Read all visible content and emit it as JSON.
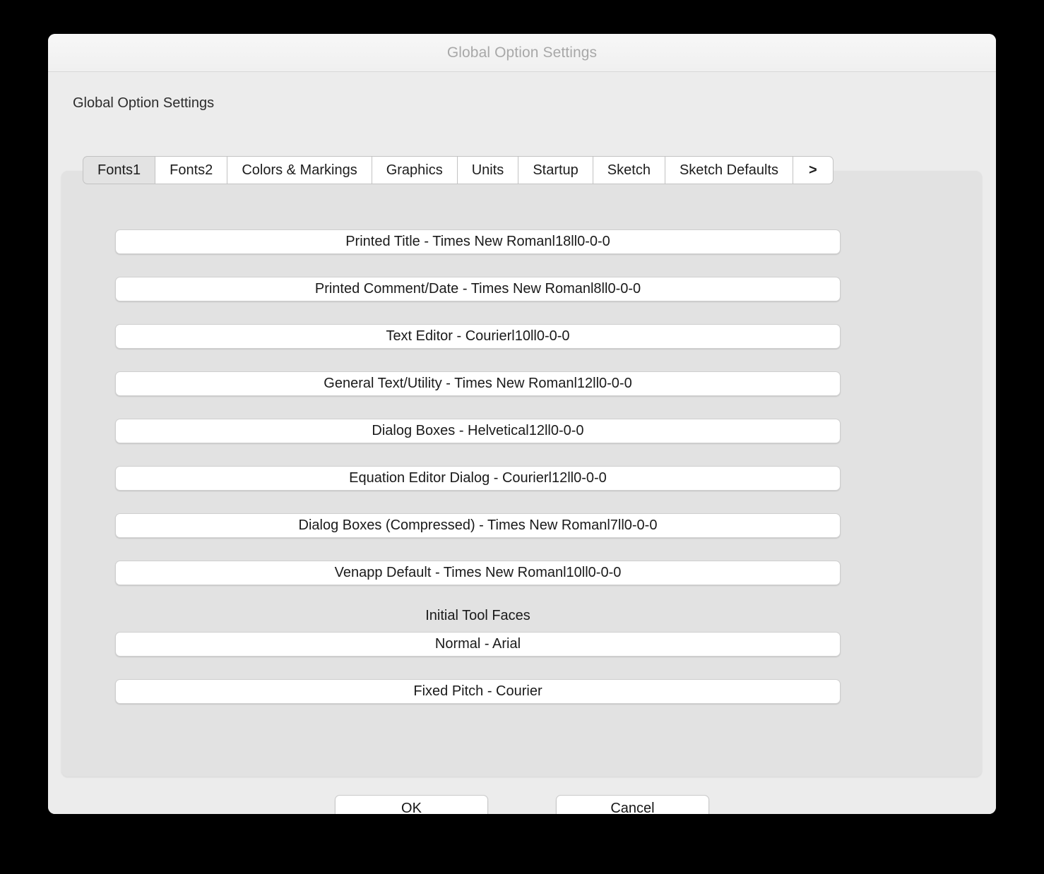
{
  "window": {
    "title": "Global Option Settings"
  },
  "group": {
    "label": "Global Option Settings"
  },
  "tabs": [
    {
      "label": "Fonts1",
      "active": true
    },
    {
      "label": "Fonts2",
      "active": false
    },
    {
      "label": "Colors & Markings",
      "active": false
    },
    {
      "label": "Graphics",
      "active": false
    },
    {
      "label": "Units",
      "active": false
    },
    {
      "label": "Startup",
      "active": false
    },
    {
      "label": "Sketch",
      "active": false
    },
    {
      "label": "Sketch Defaults",
      "active": false
    },
    {
      "label": ">",
      "active": false
    }
  ],
  "fonts1": {
    "fields": [
      {
        "value": "Printed Title - Times New Romanl18ll0-0-0"
      },
      {
        "value": "Printed Comment/Date - Times New Romanl8ll0-0-0"
      },
      {
        "value": "Text Editor - Courierl10ll0-0-0"
      },
      {
        "value": "General Text/Utility - Times New Romanl12ll0-0-0"
      },
      {
        "value": "Dialog Boxes - Helvetical12ll0-0-0"
      },
      {
        "value": "Equation Editor Dialog - Courierl12ll0-0-0"
      },
      {
        "value": "Dialog Boxes (Compressed) - Times New Romanl7ll0-0-0"
      },
      {
        "value": "Venapp Default - Times New Romanl10ll0-0-0"
      }
    ],
    "initial_tool_faces": {
      "label": "Initial Tool Faces",
      "fields": [
        {
          "value": "Normal - Arial"
        },
        {
          "value": "Fixed Pitch - Courier"
        }
      ]
    }
  },
  "footer": {
    "ok_label": "OK",
    "cancel_label": "Cancel"
  },
  "colors": {
    "window_bg": "#ececec",
    "titlebar_bg": "#f4f4f4",
    "panel_bg": "#e2e2e2",
    "field_bg": "#ffffff",
    "active_tab_bg": "#e3e3e3",
    "title_text": "#a8a8a8",
    "body_text": "#1a1a1a"
  }
}
